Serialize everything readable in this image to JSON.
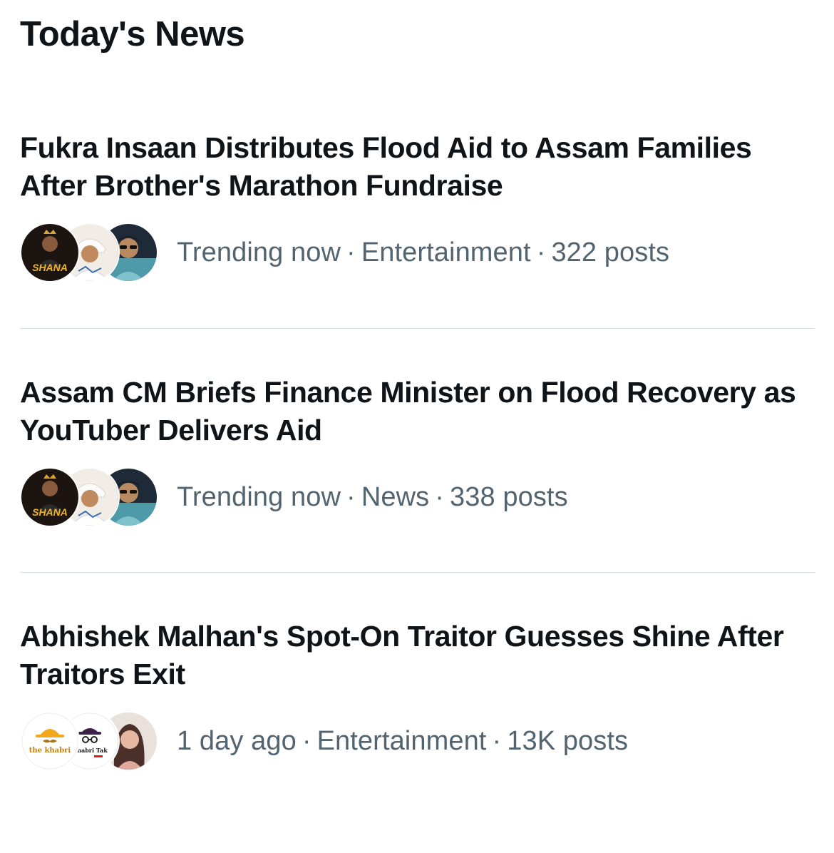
{
  "section": {
    "title": "Today's News"
  },
  "news": [
    {
      "headline": "Fukra Insaan Distributes Flood Aid to Assam Families After Brother's Marathon Fundraise",
      "time": "Trending now",
      "category": "Entertainment",
      "posts": "322 posts",
      "avatars": [
        {
          "icon": "shana-logo-avatar",
          "text": "SHANA"
        },
        {
          "icon": "man-with-turban-avatar"
        },
        {
          "icon": "man-with-sunglasses-avatar"
        }
      ]
    },
    {
      "headline": "Assam CM Briefs Finance Minister on Flood Recovery as YouTuber Delivers Aid",
      "time": "Trending now",
      "category": "News",
      "posts": "338 posts",
      "avatars": [
        {
          "icon": "shana-logo-avatar",
          "text": "SHANA"
        },
        {
          "icon": "man-with-turban-avatar"
        },
        {
          "icon": "man-with-sunglasses-avatar"
        }
      ]
    },
    {
      "headline": "Abhishek Malhan's Spot-On Traitor Guesses Shine After Traitors Exit",
      "time": "1 day ago",
      "category": "Entertainment",
      "posts": "13K posts",
      "avatars": [
        {
          "icon": "the-khabri-logo-avatar",
          "text": "the khabri"
        },
        {
          "icon": "khabri-tak-logo-avatar",
          "text": "Khabri Tak"
        },
        {
          "icon": "woman-portrait-avatar"
        }
      ]
    }
  ],
  "colors": {
    "text_primary": "#0f1419",
    "text_secondary": "#536471",
    "divider": "#d6dbdf",
    "shana_gold": "#f3b51f"
  }
}
